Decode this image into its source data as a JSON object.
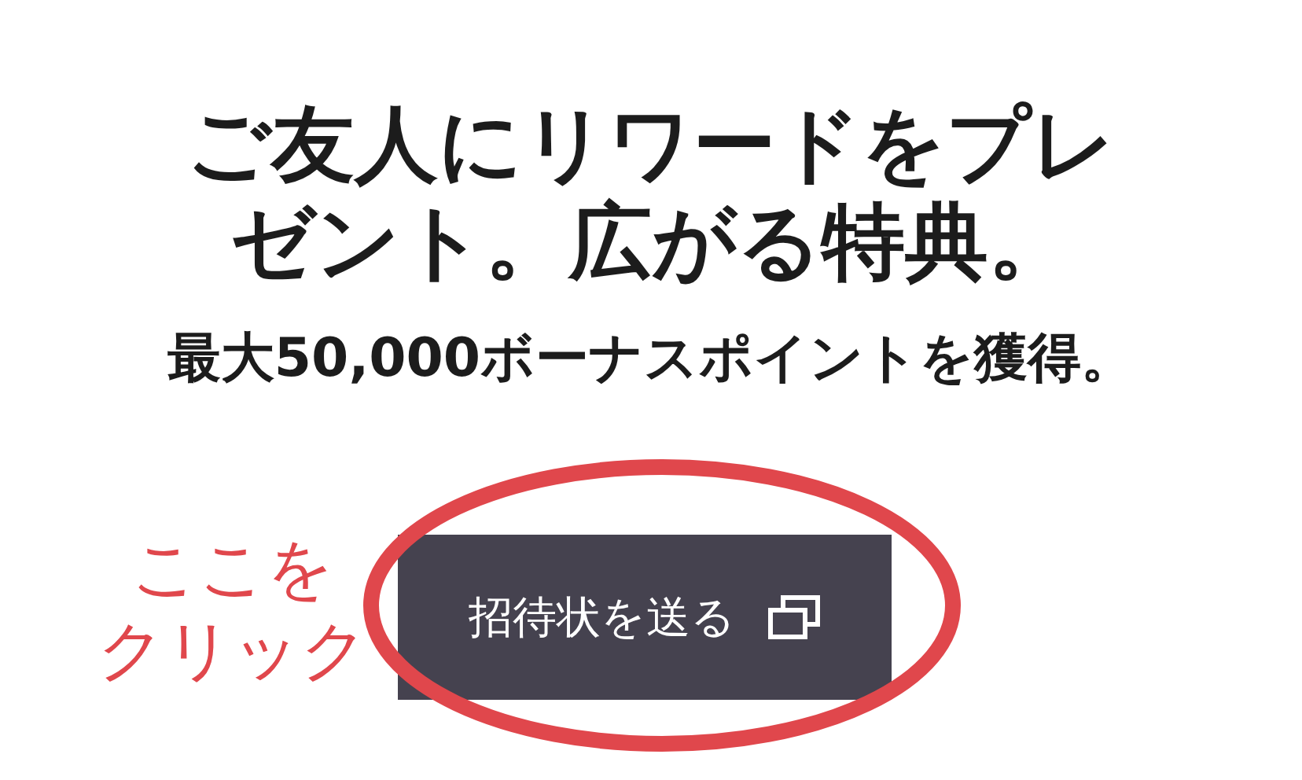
{
  "heading": "ご友人にリワードをプレゼント。広がる特典。",
  "subheading": "最大50,000ボーナスポイントを獲得。",
  "invite_button": {
    "label": "招待状を送る"
  },
  "annotation": {
    "lines": [
      "ここを",
      "クリック"
    ],
    "color": "#e0474c"
  }
}
